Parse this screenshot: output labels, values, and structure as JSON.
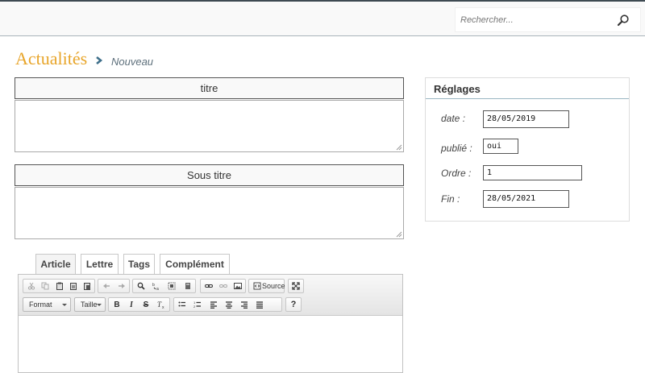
{
  "search": {
    "placeholder": "Rechercher..."
  },
  "breadcrumb": {
    "section": "Actualités",
    "current": "Nouveau"
  },
  "form": {
    "title_label": "titre",
    "subtitle_label": "Sous titre"
  },
  "settings": {
    "title": "Réglages",
    "date_label": "date :",
    "date_value": "28/05/2019",
    "published_label": "publié :",
    "published_value": "oui",
    "order_label": "Ordre :",
    "order_value": "1",
    "end_label": "Fin :",
    "end_value": "28/05/2021"
  },
  "tabs": [
    "Article",
    "Lettre",
    "Tags",
    "Complément"
  ],
  "editor": {
    "source_label": "Source",
    "format_label": "Format",
    "size_label": "Taille",
    "help_label": "?"
  },
  "colors": {
    "accent": "#e8a52a",
    "topbar_border": "#3e4a52",
    "crumb_sep": "#3e6f8a"
  }
}
